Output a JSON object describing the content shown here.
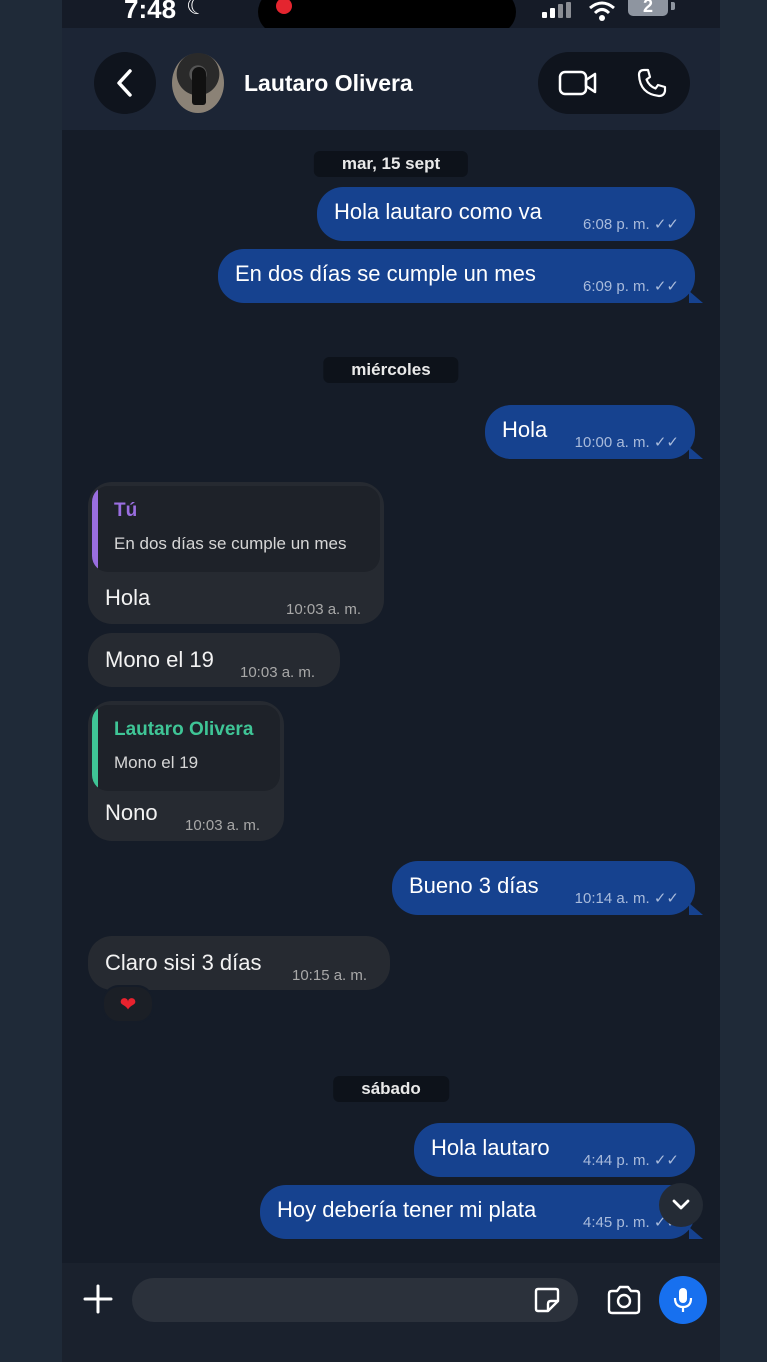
{
  "status": {
    "time": "7:48",
    "battery": "2"
  },
  "header": {
    "contact_name": "Lautaro Olivera"
  },
  "chat": {
    "date_separators": [
      "mar, 15 sept",
      "miércoles",
      "sábado"
    ],
    "outgoing": [
      {
        "text": "Hola lautaro como va",
        "time": "6:08 p. m."
      },
      {
        "text": "En dos días se cumple un mes",
        "time": "6:09 p. m."
      },
      {
        "text": "Hola",
        "time": "10:00 a. m."
      },
      {
        "text": "Bueno 3 días",
        "time": "10:14 a. m."
      },
      {
        "text": "Hola lautaro",
        "time": "4:44 p. m."
      },
      {
        "text": "Hoy debería tener mi plata",
        "time": "4:45 p. m."
      }
    ],
    "incoming": [
      {
        "quote_author": "Tú",
        "quote_text": "En dos días se cumple un mes",
        "text": "Hola",
        "time": "10:03 a. m."
      },
      {
        "text": "Mono el 19",
        "time": "10:03 a. m."
      },
      {
        "quote_author": "Lautaro Olivera",
        "quote_text": "Mono el 19",
        "text": "Nono",
        "time": "10:03 a. m."
      },
      {
        "text": "Claro sisi 3 días",
        "time": "10:15 a. m.",
        "reaction": "heart"
      }
    ],
    "read_receipt": "✓✓"
  },
  "composer": {
    "placeholder": ""
  },
  "colors": {
    "outgoing_bubble": "#16428f",
    "incoming_bubble": "#262a31",
    "quote_self": "#9a6ee0",
    "quote_contact": "#3fc596",
    "mic_button": "#1770ef"
  },
  "icons": [
    "back-arrow-icon",
    "video-camera-icon",
    "phone-icon",
    "plus-icon",
    "sticker-icon",
    "camera-icon",
    "microphone-icon",
    "chevron-down-icon",
    "heart-icon"
  ]
}
